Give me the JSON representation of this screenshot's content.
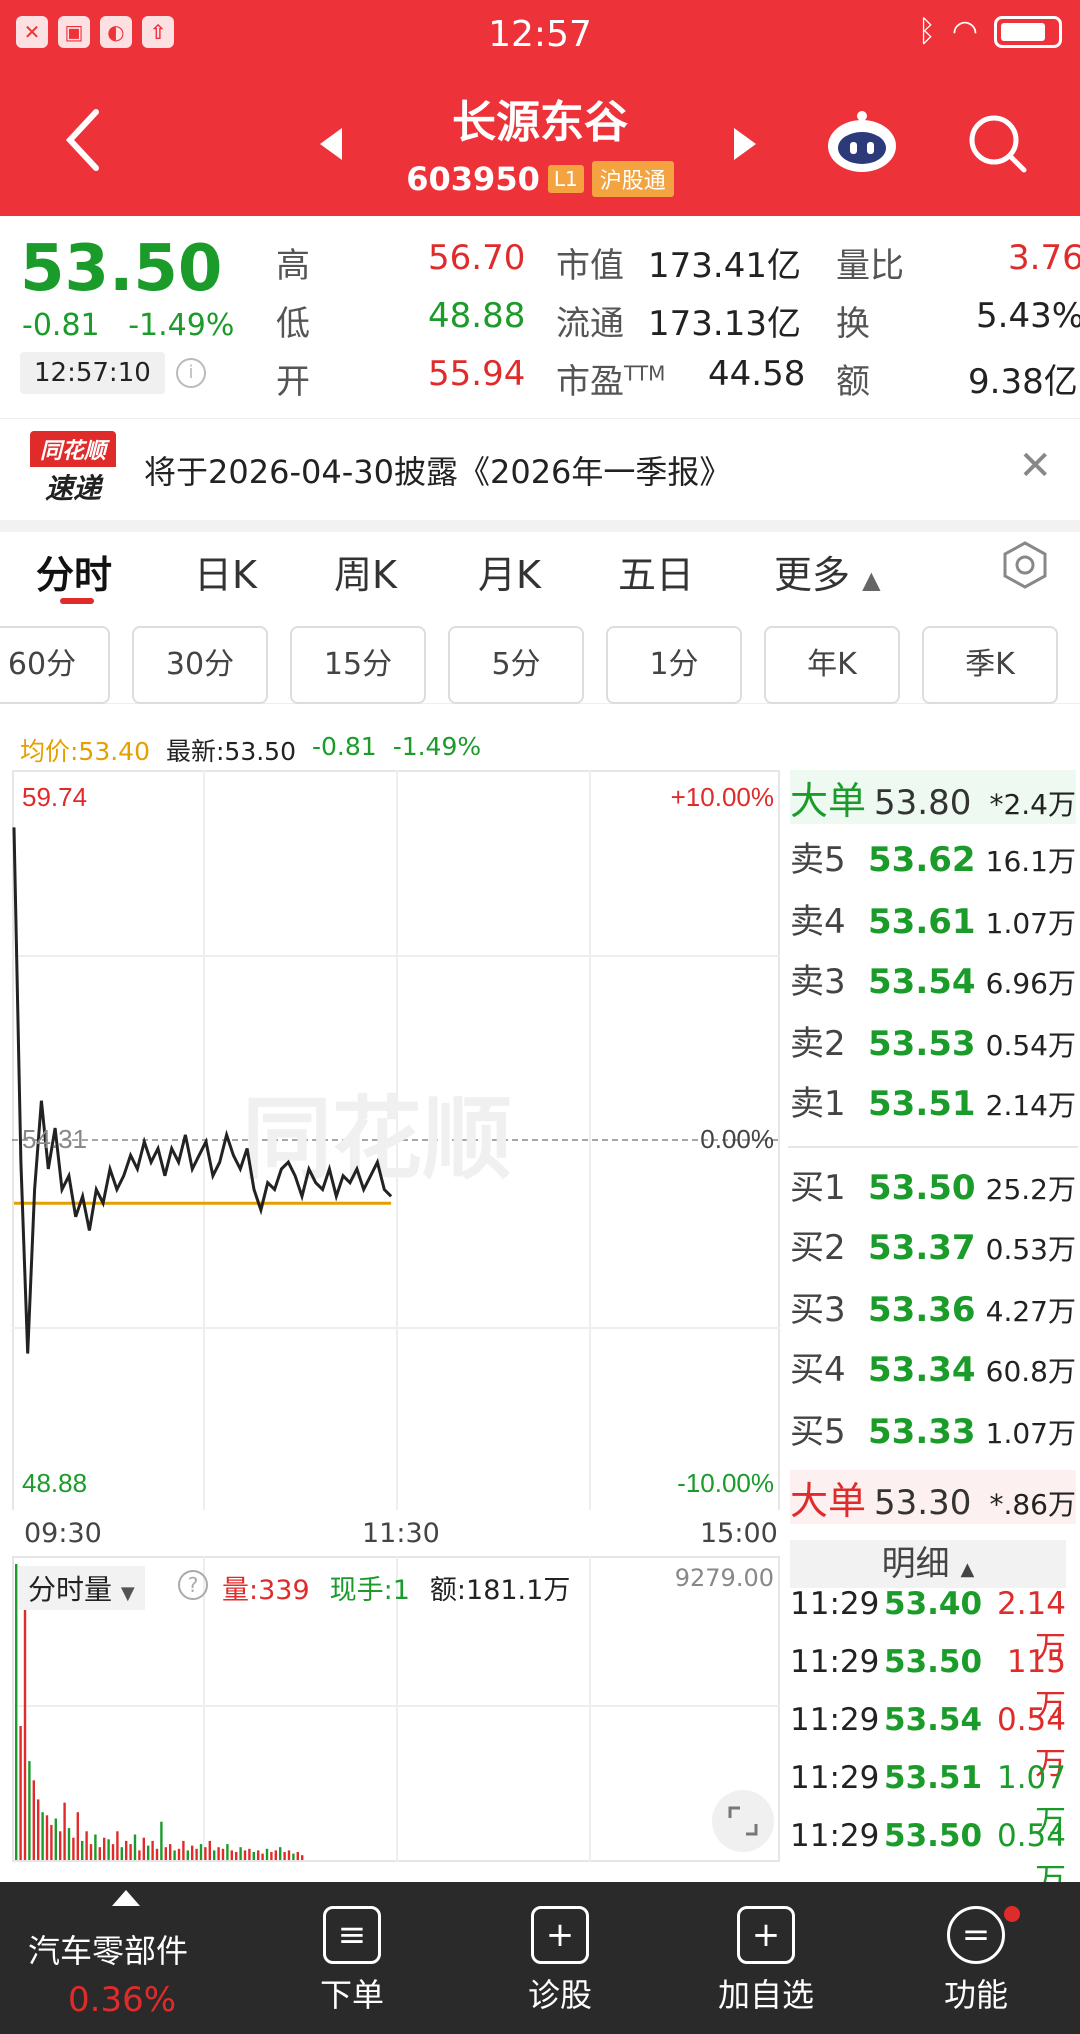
{
  "status_bar": {
    "time": "12:57",
    "left_icons": [
      "x-icon",
      "image-icon",
      "weather-icon",
      "upload-icon"
    ],
    "right_icons": [
      "bluetooth-icon",
      "wifi-icon",
      "battery-icon"
    ]
  },
  "header": {
    "stock_name": "长源东谷",
    "stock_code": "603950",
    "tag_level": "L1",
    "tag_connect": "沪股通"
  },
  "quote": {
    "price": "53.50",
    "change": "-0.81",
    "change_pct": "-1.49%",
    "time": "12:57:10",
    "high_label": "高",
    "high": "56.70",
    "low_label": "低",
    "low": "48.88",
    "open_label": "开",
    "open": "55.94",
    "mcap_label": "市值",
    "mcap": "173.41亿",
    "float_label": "流通",
    "float": "173.13亿",
    "pe_label": "市盈",
    "pe_suffix": "TTM",
    "pe": "44.58",
    "vol_ratio_label": "量比",
    "vol_ratio": "3.76",
    "turnover_label": "换",
    "turnover": "5.43%",
    "amount_label": "额",
    "amount": "9.38亿"
  },
  "notice": {
    "logo_top": "同花顺",
    "logo_bottom": "速递",
    "text": "将于2026-04-30披露《2026年一季报》"
  },
  "tabs": [
    {
      "label": "分时",
      "active": true
    },
    {
      "label": "日K"
    },
    {
      "label": "周K"
    },
    {
      "label": "月K"
    },
    {
      "label": "五日"
    },
    {
      "label": "更多"
    }
  ],
  "k_tabs": [
    "60分",
    "30分",
    "15分",
    "5分",
    "1分",
    "年K",
    "季K"
  ],
  "intraday_line": {
    "avg_label": "均价:53.40",
    "latest_label": "最新:53.50",
    "change": "-0.81",
    "change_pct": "-1.49%"
  },
  "chart_axes": {
    "top_price": "59.74",
    "bottom_price": "48.88",
    "top_pct": "+10.00%",
    "bottom_pct": "-10.00%",
    "mid_price": "54.31",
    "mid_pct": "0.00%",
    "x_start": "09:30",
    "x_mid": "11:30",
    "x_end": "15:00",
    "watermark": "同花顺"
  },
  "volume_panel": {
    "selector": "分时量",
    "vol_label": "量:339",
    "hand_label": "现手:1",
    "amount_label": "额:181.1万",
    "max_value": "9279.00"
  },
  "chart_data": [
    {
      "type": "line",
      "title": "",
      "x": [
        "09:30",
        "11:30",
        "15:00"
      ],
      "series": [],
      "ylim": [
        48.88,
        59.74
      ],
      "price_series": [
        58.9,
        54.0,
        51.2,
        53.6,
        54.9,
        53.9,
        54.5,
        53.6,
        53.8,
        53.2,
        53.5,
        53.0,
        53.6,
        53.4,
        53.9,
        53.6,
        53.8,
        54.1,
        53.9,
        54.3,
        54.0,
        54.2,
        53.8,
        54.2,
        54.0,
        54.4,
        53.9,
        54.1,
        54.3,
        53.8,
        54.0,
        54.4,
        54.1,
        53.9,
        54.2,
        53.6,
        53.3,
        53.7,
        53.6,
        53.9,
        54.0,
        53.8,
        53.5,
        53.9,
        53.7,
        53.6,
        53.9,
        53.5,
        53.8,
        53.7,
        53.9,
        53.6,
        53.8,
        54.0,
        53.6,
        53.5
      ],
      "avg_series": [
        53.4,
        53.4,
        53.4,
        53.4,
        53.4,
        53.4,
        53.4,
        53.4,
        53.4,
        53.4,
        53.4,
        53.4,
        53.4,
        53.4,
        53.4,
        53.4,
        53.4,
        53.4,
        53.4,
        53.4,
        53.4,
        53.4,
        53.4,
        53.4,
        53.4,
        53.4,
        53.4,
        53.4,
        53.4,
        53.4,
        53.4,
        53.4,
        53.4,
        53.4,
        53.4,
        53.4,
        53.4,
        53.4,
        53.4,
        53.4,
        53.4,
        53.4,
        53.4,
        53.4,
        53.4,
        53.4,
        53.4,
        53.4,
        53.4,
        53.4,
        53.4,
        53.4,
        53.4,
        53.4,
        53.4,
        53.4
      ],
      "reference_price": 54.31,
      "grid": true
    },
    {
      "type": "bar",
      "title": "",
      "ylim": [
        0,
        9279
      ],
      "values": [
        9279,
        4200,
        8300,
        3100,
        2500,
        1900,
        1500,
        1400,
        1100,
        1300,
        900,
        1800,
        1000,
        700,
        1500,
        600,
        900,
        500,
        800,
        400,
        700,
        650,
        500,
        900,
        400,
        600,
        500,
        800,
        300,
        700,
        450,
        600,
        350,
        1200,
        400,
        500,
        300,
        350,
        600,
        300,
        450,
        350,
        500,
        400,
        600,
        300,
        400,
        350,
        500,
        300,
        250,
        400,
        300,
        350,
        250,
        300,
        200,
        350,
        250,
        300,
        400,
        250,
        300,
        200,
        250,
        150
      ]
    }
  ],
  "order_book": {
    "big_sell": {
      "label": "大单",
      "price": "53.80",
      "vol": "*2.4万"
    },
    "asks": [
      {
        "label": "卖5",
        "price": "53.62",
        "vol": "16.1万"
      },
      {
        "label": "卖4",
        "price": "53.61",
        "vol": "1.07万"
      },
      {
        "label": "卖3",
        "price": "53.54",
        "vol": "6.96万"
      },
      {
        "label": "卖2",
        "price": "53.53",
        "vol": "0.54万"
      },
      {
        "label": "卖1",
        "price": "53.51",
        "vol": "2.14万"
      }
    ],
    "bids": [
      {
        "label": "买1",
        "price": "53.50",
        "vol": "25.2万"
      },
      {
        "label": "买2",
        "price": "53.37",
        "vol": "0.53万"
      },
      {
        "label": "买3",
        "price": "53.36",
        "vol": "4.27万"
      },
      {
        "label": "买4",
        "price": "53.34",
        "vol": "60.8万"
      },
      {
        "label": "买5",
        "price": "53.33",
        "vol": "1.07万"
      }
    ],
    "big_buy": {
      "label": "大单",
      "price": "53.30",
      "vol": "*.86万"
    }
  },
  "detail": {
    "header": "明细",
    "rows": [
      {
        "time": "11:29",
        "price": "53.40",
        "vol": "2.14万",
        "color": "red"
      },
      {
        "time": "11:29",
        "price": "53.50",
        "vol": "115万",
        "color": "red"
      },
      {
        "time": "11:29",
        "price": "53.54",
        "vol": "0.54万",
        "color": "red"
      },
      {
        "time": "11:29",
        "price": "53.51",
        "vol": "1.07万",
        "color": "green"
      },
      {
        "time": "11:29",
        "price": "53.50",
        "vol": "0.54万",
        "color": "green"
      }
    ]
  },
  "bottom_bar": {
    "sector": "汽车零部件",
    "sector_change": "0.36%",
    "items": [
      "下单",
      "诊股",
      "加自选",
      "功能"
    ]
  },
  "colors": {
    "header_red": "#ee3239",
    "up_red": "#e02b2b",
    "down_green": "#1a9b2a",
    "avg_orange": "#e5a000"
  }
}
